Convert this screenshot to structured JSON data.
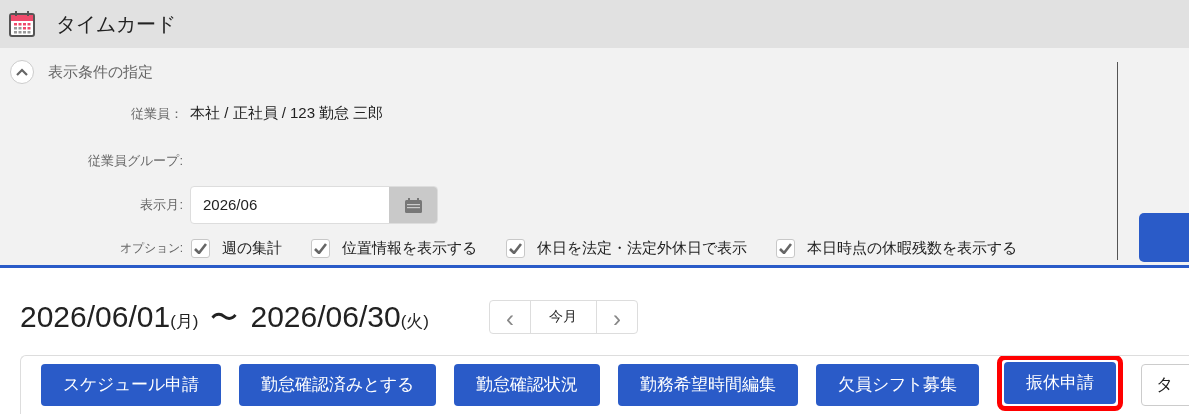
{
  "header": {
    "title": "タイムカード"
  },
  "conditions": {
    "title": "表示条件の指定",
    "expanded": true,
    "employee": {
      "label": "従業員：",
      "value": "本社 / 正社員 / 123 勤怠 三郎"
    },
    "group": {
      "label": "従業員グループ:"
    },
    "month": {
      "label": "表示月:",
      "value": "2026/06"
    },
    "options": {
      "label": "オプション:",
      "items": [
        {
          "label": "週の集計",
          "checked": true
        },
        {
          "label": "位置情報を表示する",
          "checked": true
        },
        {
          "label": "休日を法定・法定外休日で表示",
          "checked": true
        },
        {
          "label": "本日時点の休暇残数を表示する",
          "checked": true
        }
      ]
    }
  },
  "period": {
    "start": "2026/06/01",
    "start_day": "(月)",
    "separator": "〜",
    "end": "2026/06/30",
    "end_day": "(火)"
  },
  "nav": {
    "prev": "‹",
    "current": "今月",
    "next": "›"
  },
  "toolbar": [
    {
      "label": "スケジュール申請",
      "kind": "primary",
      "highlighted": false
    },
    {
      "label": "勤怠確認済みとする",
      "kind": "primary",
      "highlighted": false
    },
    {
      "label": "勤怠確認状況",
      "kind": "primary",
      "highlighted": false
    },
    {
      "label": "勤務希望時間編集",
      "kind": "primary",
      "highlighted": false
    },
    {
      "label": "欠員シフト募集",
      "kind": "primary",
      "highlighted": false
    },
    {
      "label": "振休申請",
      "kind": "primary",
      "highlighted": true
    },
    {
      "label": "タ",
      "kind": "outline",
      "highlighted": false
    }
  ]
}
